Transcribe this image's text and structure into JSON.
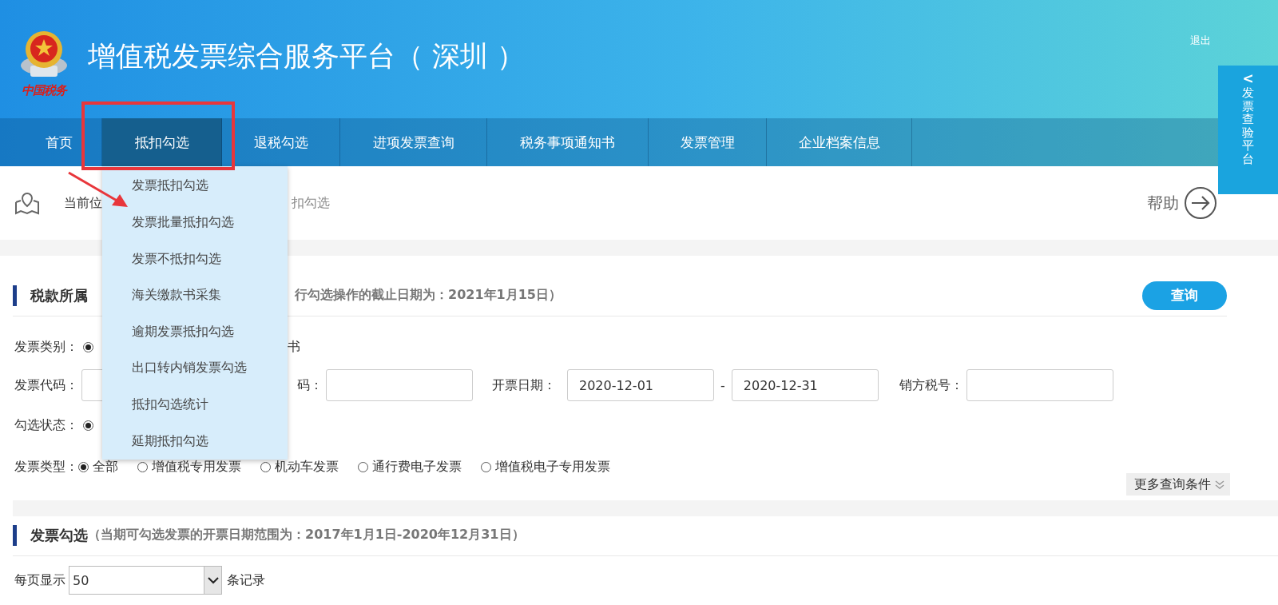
{
  "header": {
    "logo_text": "中国税务",
    "title": "增值税发票综合服务平台（ 深圳 ）",
    "logout": "退出"
  },
  "nav": [
    {
      "label": "首页",
      "selected": false
    },
    {
      "label": "抵扣勾选",
      "selected": true
    },
    {
      "label": "退税勾选",
      "selected": false
    },
    {
      "label": "进项发票查询",
      "selected": false
    },
    {
      "label": "税务事项通知书",
      "selected": false
    },
    {
      "label": "发票管理",
      "selected": false
    },
    {
      "label": "企业档案信息",
      "selected": false
    }
  ],
  "dropdown": {
    "items": [
      "发票抵扣勾选",
      "发票批量抵扣勾选",
      "发票不抵扣勾选",
      "海关缴款书采集",
      "逾期发票抵扣勾选",
      "出口转内销发票勾选",
      "抵扣勾选统计",
      "延期抵扣勾选"
    ]
  },
  "side_tab": {
    "arrow": "<",
    "label": "发票查验平台"
  },
  "breadcrumb": {
    "start": "当前位",
    "end": "扣勾选"
  },
  "help": "帮助",
  "tax_period_section": {
    "title": "税款所属",
    "note": "行勾选操作的截止日期为：2021年1月15日）",
    "query_button": "查询"
  },
  "invoice_category": {
    "label": "发票类别：",
    "selected": true,
    "tail": "书"
  },
  "code_row": {
    "code_label": "发票代码：",
    "number_label": "码：",
    "date_label": "开票日期：",
    "date_from": "2020-12-01",
    "date_sep": "-",
    "date_to": "2020-12-31",
    "seller_label": "销方税号："
  },
  "check_status": {
    "label": "勾选状态：",
    "selected": true
  },
  "invoice_types": {
    "label": "发票类型：",
    "options": [
      {
        "label": "全部",
        "selected": true
      },
      {
        "label": "增值税专用发票",
        "selected": false
      },
      {
        "label": "机动车发票",
        "selected": false
      },
      {
        "label": "通行费电子发票",
        "selected": false
      },
      {
        "label": "增值税电子专用发票",
        "selected": false
      }
    ]
  },
  "more_conditions": "更多查询条件",
  "invoice_section": {
    "title": "发票勾选",
    "note": "（当期可勾选发票的开票日期范围为：2017年1月1日-2020年12月31日）"
  },
  "page_size": {
    "label": "每页显示",
    "value": "50",
    "suffix": "条记录"
  }
}
